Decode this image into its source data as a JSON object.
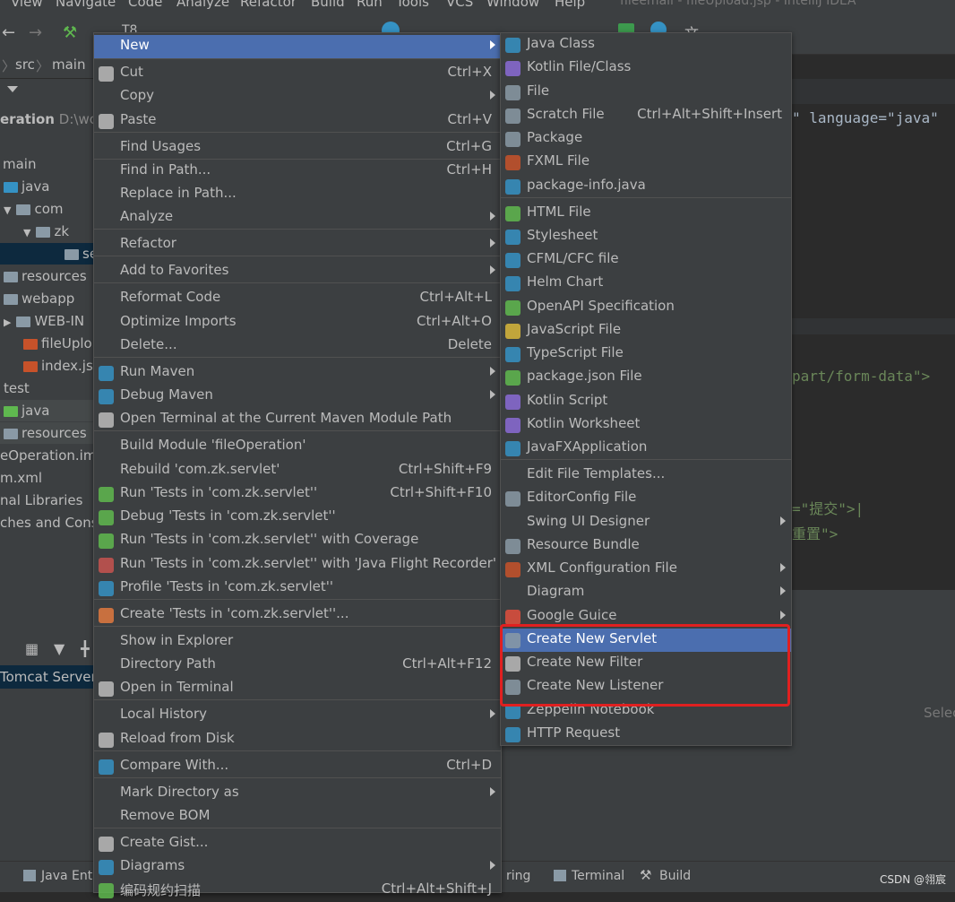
{
  "menubar": {
    "items": [
      "View",
      "Navigate",
      "Code",
      "Analyze",
      "Refactor",
      "Build",
      "Run",
      "Tools",
      "VCS",
      "Window",
      "Help"
    ],
    "title": "fileemail - fileUpload.jsp - IntelliJ IDEA"
  },
  "toolbar": {
    "run_config": "T8"
  },
  "breadcrumb": [
    "src",
    "main"
  ],
  "project_tree": {
    "root_label": "eration",
    "root_path": "D:\\wo",
    "items": [
      "main",
      "java",
      "com",
      "zk",
      "se",
      "resources",
      "webapp",
      "WEB-IN",
      "fileUplo",
      "index.js",
      "test",
      "java",
      "resources",
      "eOperation.iml",
      "m.xml",
      "nal Libraries",
      "ches and Conso"
    ]
  },
  "editor": {
    "line1": "\" language=\"java\"",
    "line2": "part/form-data\">",
    "line3": "=\"提交\">|",
    "line4": "重置\">"
  },
  "bottom_panel": {
    "tomcat_label": "Tomcat Server",
    "select_hint": "Selec"
  },
  "context_menu": {
    "items": [
      {
        "label": "New",
        "shortcut": "",
        "submenu": true
      },
      {
        "label": "Cut",
        "shortcut": "Ctrl+X"
      },
      {
        "label": "Copy",
        "shortcut": "",
        "submenu": true
      },
      {
        "label": "Paste",
        "shortcut": "Ctrl+V"
      },
      {
        "label": "Find Usages",
        "shortcut": "Ctrl+G"
      },
      {
        "label": "Find in Path...",
        "shortcut": "Ctrl+H"
      },
      {
        "label": "Replace in Path...",
        "shortcut": ""
      },
      {
        "label": "Analyze",
        "shortcut": "",
        "submenu": true
      },
      {
        "label": "Refactor",
        "shortcut": "",
        "submenu": true
      },
      {
        "label": "Add to Favorites",
        "shortcut": "",
        "submenu": true
      },
      {
        "label": "Reformat Code",
        "shortcut": "Ctrl+Alt+L"
      },
      {
        "label": "Optimize Imports",
        "shortcut": "Ctrl+Alt+O"
      },
      {
        "label": "Delete...",
        "shortcut": "Delete"
      },
      {
        "label": "Run Maven",
        "shortcut": "",
        "submenu": true
      },
      {
        "label": "Debug Maven",
        "shortcut": "",
        "submenu": true
      },
      {
        "label": "Open Terminal at the Current Maven Module Path",
        "shortcut": ""
      },
      {
        "label": "Build Module 'fileOperation'",
        "shortcut": ""
      },
      {
        "label": "Rebuild 'com.zk.servlet'",
        "shortcut": "Ctrl+Shift+F9"
      },
      {
        "label": "Run 'Tests in 'com.zk.servlet''",
        "shortcut": "Ctrl+Shift+F10"
      },
      {
        "label": "Debug 'Tests in 'com.zk.servlet''",
        "shortcut": ""
      },
      {
        "label": "Run 'Tests in 'com.zk.servlet'' with Coverage",
        "shortcut": ""
      },
      {
        "label": "Run 'Tests in 'com.zk.servlet'' with 'Java Flight Recorder'",
        "shortcut": ""
      },
      {
        "label": "Profile 'Tests in 'com.zk.servlet''",
        "shortcut": ""
      },
      {
        "label": "Create 'Tests in 'com.zk.servlet''...",
        "shortcut": ""
      },
      {
        "label": "Show in Explorer",
        "shortcut": ""
      },
      {
        "label": "Directory Path",
        "shortcut": "Ctrl+Alt+F12"
      },
      {
        "label": "Open in Terminal",
        "shortcut": ""
      },
      {
        "label": "Local History",
        "shortcut": "",
        "submenu": true
      },
      {
        "label": "Reload from Disk",
        "shortcut": ""
      },
      {
        "label": "Compare With...",
        "shortcut": "Ctrl+D"
      },
      {
        "label": "Mark Directory as",
        "shortcut": "",
        "submenu": true
      },
      {
        "label": "Remove BOM",
        "shortcut": ""
      },
      {
        "label": "Create Gist...",
        "shortcut": ""
      },
      {
        "label": "Diagrams",
        "shortcut": "",
        "submenu": true
      },
      {
        "label": "编码规约扫描",
        "shortcut": "Ctrl+Alt+Shift+J"
      }
    ]
  },
  "new_submenu": {
    "items": [
      {
        "label": "Java Class",
        "shortcut": ""
      },
      {
        "label": "Kotlin File/Class",
        "shortcut": ""
      },
      {
        "label": "File",
        "shortcut": ""
      },
      {
        "label": "Scratch File",
        "shortcut": "Ctrl+Alt+Shift+Insert"
      },
      {
        "label": "Package",
        "shortcut": ""
      },
      {
        "label": "FXML File",
        "shortcut": ""
      },
      {
        "label": "package-info.java",
        "shortcut": ""
      },
      {
        "label": "HTML File",
        "shortcut": ""
      },
      {
        "label": "Stylesheet",
        "shortcut": ""
      },
      {
        "label": "CFML/CFC file",
        "shortcut": ""
      },
      {
        "label": "Helm Chart",
        "shortcut": ""
      },
      {
        "label": "OpenAPI Specification",
        "shortcut": ""
      },
      {
        "label": "JavaScript File",
        "shortcut": ""
      },
      {
        "label": "TypeScript File",
        "shortcut": ""
      },
      {
        "label": "package.json File",
        "shortcut": ""
      },
      {
        "label": "Kotlin Script",
        "shortcut": ""
      },
      {
        "label": "Kotlin Worksheet",
        "shortcut": ""
      },
      {
        "label": "JavaFXApplication",
        "shortcut": ""
      },
      {
        "label": "Edit File Templates...",
        "shortcut": ""
      },
      {
        "label": "EditorConfig File",
        "shortcut": ""
      },
      {
        "label": "Swing UI Designer",
        "shortcut": "",
        "submenu": true
      },
      {
        "label": "Resource Bundle",
        "shortcut": ""
      },
      {
        "label": "XML Configuration File",
        "shortcut": "",
        "submenu": true
      },
      {
        "label": "Diagram",
        "shortcut": "",
        "submenu": true
      },
      {
        "label": "Google Guice",
        "shortcut": "",
        "submenu": true
      },
      {
        "label": "Create New Servlet",
        "shortcut": ""
      },
      {
        "label": "Create New Filter",
        "shortcut": ""
      },
      {
        "label": "Create New Listener",
        "shortcut": ""
      },
      {
        "label": "Zeppelin Notebook",
        "shortcut": ""
      },
      {
        "label": "HTTP Request",
        "shortcut": ""
      }
    ]
  },
  "statusbar": {
    "items": [
      "Java Ente",
      "ring",
      "Terminal",
      "Build"
    ],
    "watermark": "CSDN @翎宸"
  },
  "colors": {
    "selection": "#4b6eaf",
    "highlight_box": "#e02020",
    "menu_bg": "#3c3f41"
  }
}
